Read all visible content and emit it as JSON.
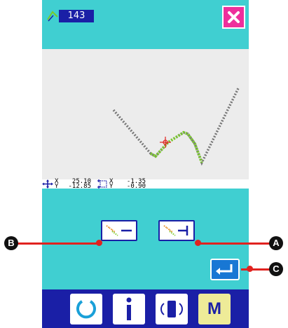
{
  "header": {
    "pattern_number": "143"
  },
  "coordinates": {
    "cursor": {
      "x_label": "X",
      "x_value": "25.10",
      "y_label": "Y",
      "y_value": "-12.85"
    },
    "offset": {
      "x_label": "X",
      "x_value": "-1.35",
      "y_label": "Y",
      "y_value": "-0.90"
    }
  },
  "callouts": {
    "a": "A",
    "b": "B",
    "c": "C"
  },
  "nav": {
    "model_label": "M"
  },
  "colors": {
    "panel": "#40cfd1",
    "navy": "#1a1fa6",
    "close": "#ee2f9c",
    "enter": "#1877d4",
    "stitch_existing": "#777777",
    "stitch_new": "#7ac92c",
    "cursor": "#e1221f"
  },
  "icons": [
    "pattern-icon",
    "close-icon",
    "cursor-position-icon",
    "offset-icon",
    "stitch-line-left-icon",
    "stitch-line-right-icon",
    "enter-icon",
    "reset-icon",
    "info-icon",
    "communication-icon",
    "model-icon"
  ]
}
